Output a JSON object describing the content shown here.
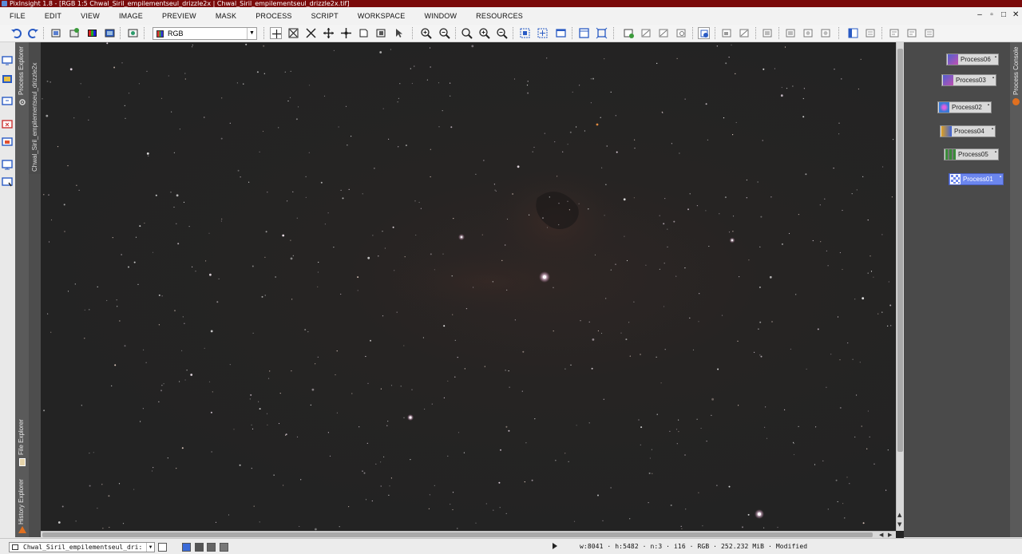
{
  "window": {
    "title": "PixInsight 1.8 - [RGB 1:5 Chwal_Siril_empilementseul_drizzle2x | Chwal_Siril_empilementseul_drizzle2x.tif]",
    "controls": [
      "‒",
      "▫",
      "□",
      "✕"
    ]
  },
  "menu": [
    "FILE",
    "EDIT",
    "VIEW",
    "IMAGE",
    "PREVIEW",
    "MASK",
    "PROCESS",
    "SCRIPT",
    "WORKSPACE",
    "WINDOW",
    "RESOURCES"
  ],
  "toolbar": {
    "channel_value": "RGB",
    "icons": [
      "undo-icon",
      "redo-icon",
      "clone-icon",
      "reset-icon",
      "rgb-icon",
      "screen-icon",
      "view-icon",
      "pan-icon",
      "zoom-fit-icon",
      "zoom-area-icon",
      "move-icon",
      "readout-icon",
      "preview-icon",
      "select-icon",
      "zoom-in-icon",
      "zoom-out-icon",
      "zoom-1-icon",
      "zoom-in2-icon",
      "zoom-out2-icon",
      "fit-view-icon",
      "fit-window-icon",
      "window-icon",
      "auto-stretch-icon",
      "full-screen-icon",
      "stf-icon",
      "stf-linked-icon",
      "stf-auto-icon",
      "stf-reset-icon",
      "stf-boost-icon",
      "mask-show-icon",
      "mask-invert-icon",
      "mask-enable-icon",
      "mask-red-icon",
      "mask-green-icon",
      "mask-blue-icon",
      "split-icon",
      "compare-icon",
      "copy-icon",
      "paste-icon"
    ]
  },
  "left_tabs": {
    "process_explorer": "Process Explorer",
    "file_explorer": "File Explorer",
    "history_explorer": "History Explorer"
  },
  "image_window": {
    "tab_label": "Chwal_Siril_empilementseul_drizzle2x"
  },
  "process_icons": [
    {
      "label": "Process06"
    },
    {
      "label": "Process03"
    },
    {
      "label": "Process02"
    },
    {
      "label": "Process04"
    },
    {
      "label": "Process05"
    },
    {
      "label": "Process01"
    }
  ],
  "right_tabs": {
    "process_console": "Process Console"
  },
  "statusbar": {
    "view_name": "Chwal_Siril_empilementseul_dri:",
    "width": "w:8041",
    "height": "h:5482",
    "channels": "n:3",
    "sample": "i16",
    "color_space": "RGB",
    "memory": "252.232 MiB",
    "state": "Modified"
  },
  "colors": {
    "title_bar": "#7a0a0a",
    "sky": "#242424",
    "workspace": "#4a4a4a",
    "selected_icon": "#6b86ee"
  }
}
